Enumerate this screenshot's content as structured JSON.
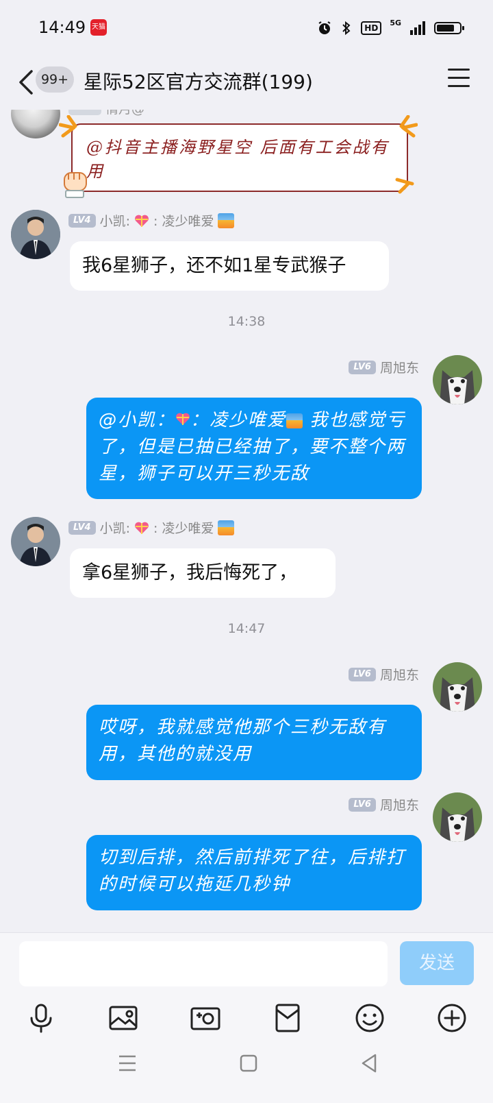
{
  "status_bar": {
    "time": "14:49",
    "tmall_label": "天猫",
    "network": "5G",
    "hd_label": "HD"
  },
  "header": {
    "unread_count": "99+",
    "title": "星际52区官方交流群(199)"
  },
  "messages": [
    {
      "id": "m1",
      "sender_fragment": "情月@",
      "text": "@抖音主播海野星空 后面有工会战有用"
    },
    {
      "id": "m2",
      "level": "LV4",
      "sender_name": "小凯:",
      "sender_suffix": ": 凌少唯爱",
      "text": "我6星狮子，还不如1星专武猴子"
    },
    {
      "id": "t1",
      "time": "14:38"
    },
    {
      "id": "m3",
      "level": "LV6",
      "sender_name": "周旭东",
      "text_prefix": "@小凯：",
      "text_mid": "：凌少唯爱",
      "text": "我也感觉亏了，但是已抽已经抽了，要不整个两星，狮子可以开三秒无敌"
    },
    {
      "id": "m4",
      "level": "LV4",
      "sender_name": "小凯:",
      "sender_suffix": ": 凌少唯爱",
      "text": "拿6星狮子，我后悔死了，"
    },
    {
      "id": "t2",
      "time": "14:47"
    },
    {
      "id": "m5",
      "level": "LV6",
      "sender_name": "周旭东",
      "text": "哎呀，我就感觉他那个三秒无敌有用，其他的就没用"
    },
    {
      "id": "m6",
      "level": "LV6",
      "sender_name": "周旭东",
      "text": "切到后排，然后前排死了往，后排打的时候可以拖延几秒钟"
    }
  ],
  "input_bar": {
    "send_label": "发送",
    "placeholder": ""
  },
  "tools": [
    "microphone-icon",
    "image-icon",
    "camera-icon",
    "red-packet-icon",
    "emoji-icon",
    "plus-icon"
  ],
  "colors": {
    "outgoing_bubble": "#0b96f5",
    "send_button": "#8fcdfa",
    "background": "#f0f0f5"
  }
}
